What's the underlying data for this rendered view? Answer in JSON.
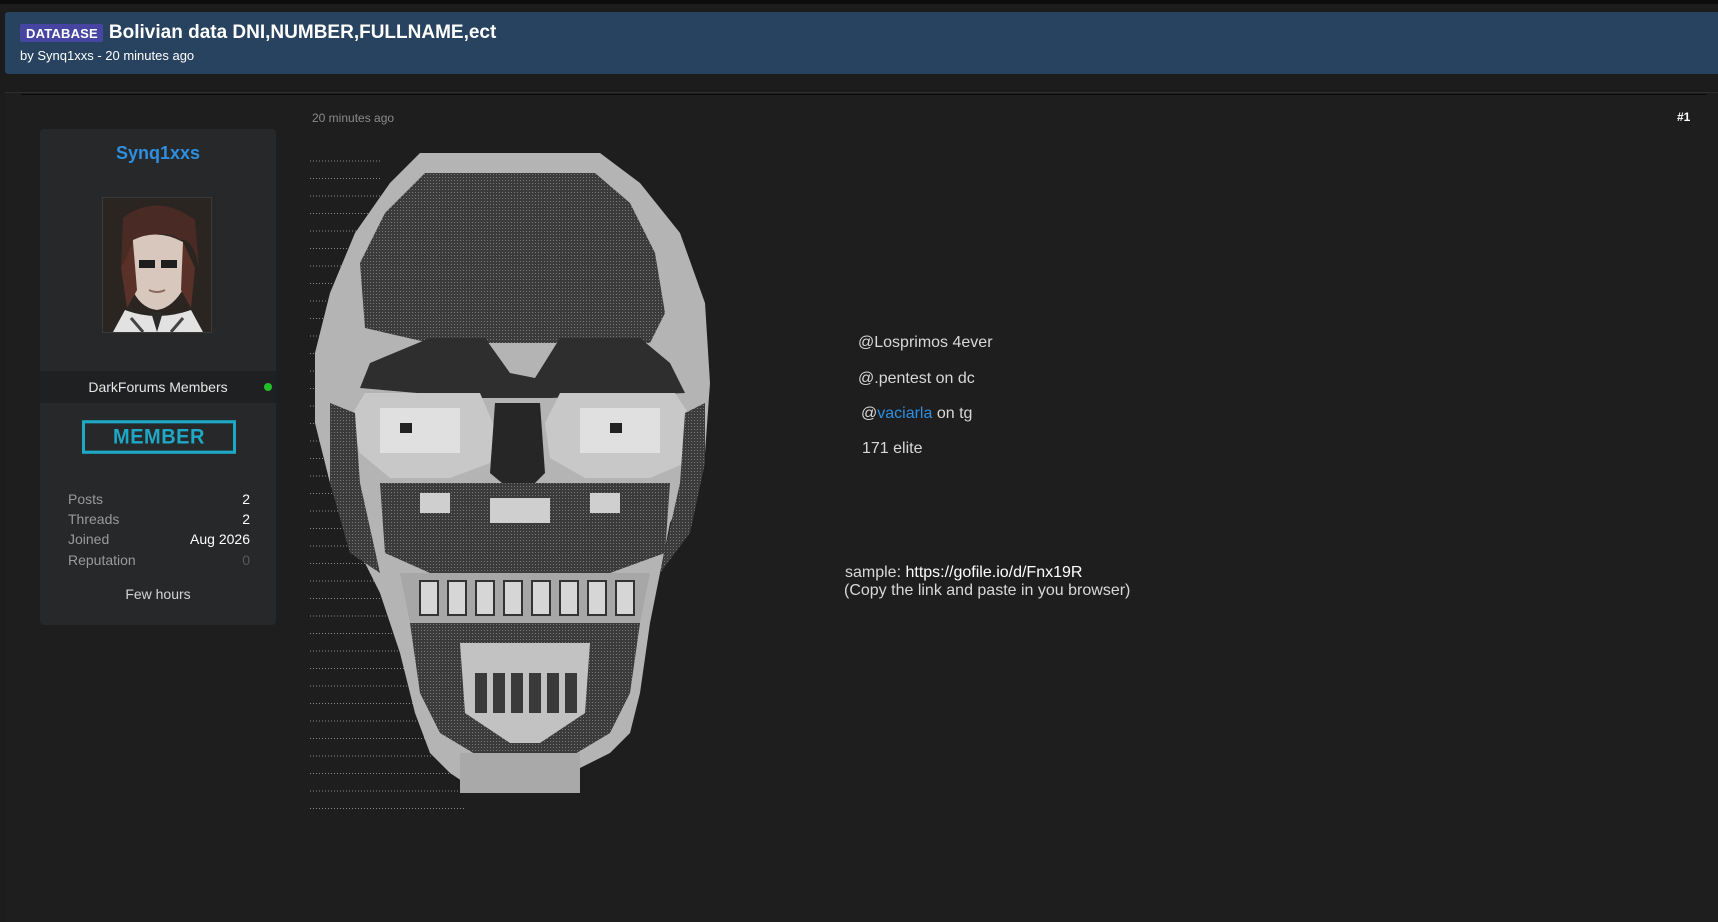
{
  "thread": {
    "prefix": "DATABASE",
    "title": "Bolivian data DNI,NUMBER,FULLNAME,ect",
    "meta": "by Synq1xxs - 20 minutes ago"
  },
  "author": {
    "username": "Synq1xxs",
    "group": "DarkForums Members",
    "badge": "MEMBER",
    "stats": [
      {
        "label": "Posts",
        "value": "2"
      },
      {
        "label": "Threads",
        "value": "2"
      },
      {
        "label": "Joined",
        "value": "Aug 2026"
      },
      {
        "label": "Reputation",
        "value": "0"
      }
    ],
    "last_seen": "Few hours",
    "colors": {
      "username": "#2d8fe0",
      "badge": "#1fa8c6",
      "online": "#22c026"
    }
  },
  "post": {
    "date": "20 minutes ago",
    "number": "#1",
    "lines": [
      "@Losprimos 4ever",
      "@.pentest on dc"
    ],
    "tg_prefix": "@",
    "tg_handle": "vaciarla",
    "tg_suffix": " on tg",
    "elite_line": "171 elite",
    "sample_label": "sample: ",
    "sample_link": "https://gofile.io/d/Fnx19R",
    "sample_note": "(Copy the link and paste in you browser)"
  },
  "colors": {
    "header_bg": "#27435f",
    "page_bg": "#1c1c1d",
    "prefix_bg": "#4646a2",
    "link": "#2d8fe0"
  }
}
